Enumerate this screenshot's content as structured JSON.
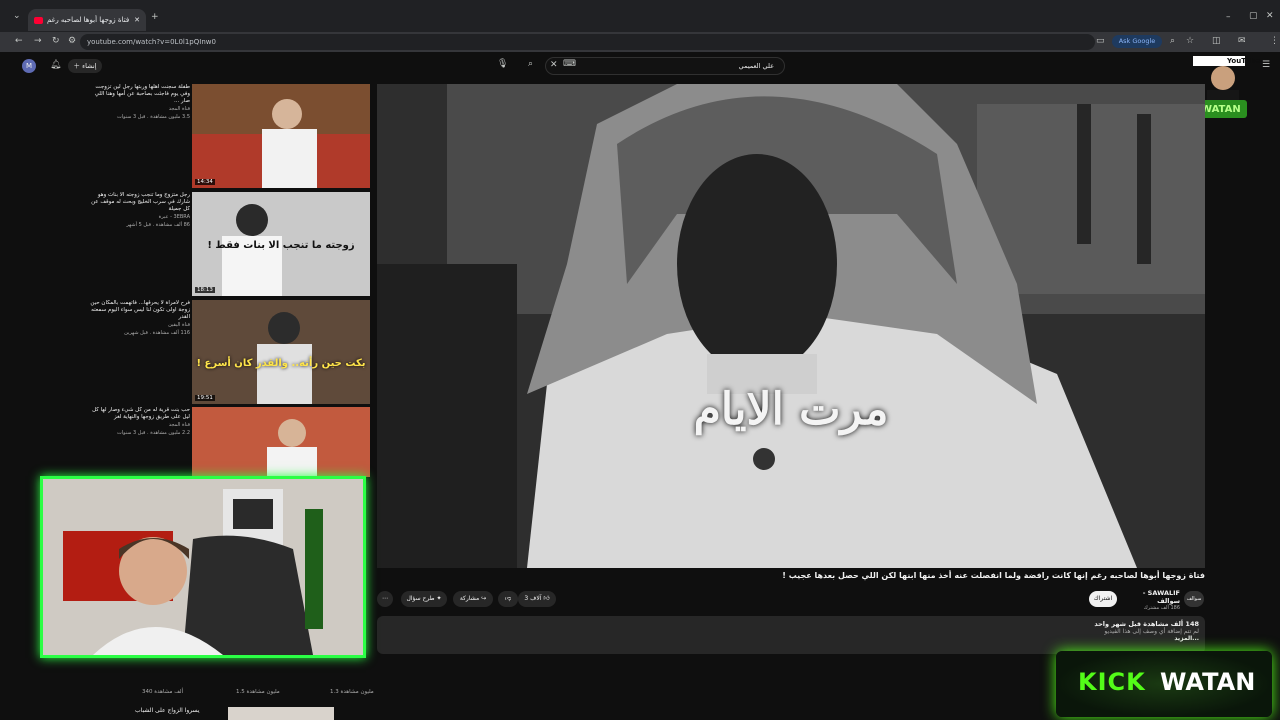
{
  "browser": {
    "tab_title": "فتاة زوجها أبوها لصاحبه رغم",
    "url": "youtube.com/watch?v=0L0l1pQInw0",
    "ask_google": "Ask Google",
    "avatar_letter": "M"
  },
  "masthead": {
    "search_value": "علي العميمي",
    "create_label": "إنشاء",
    "logo_text": "YouTube"
  },
  "player": {
    "overlay_text": "مرت الايام"
  },
  "video": {
    "title": "فتاة زوجها أبوها لصاحبه رغم إنها كانت رافضة ولما انفصلت عنه أخذ منها ابنها لكن اللي حصل بعدها عجيب !",
    "channel": "SAWALIF - سوالف",
    "subscribers": "186 ألف مشترك",
    "subscribe_label": "اشتراك",
    "likes": "3 آلاف",
    "share_label": "مشاركة",
    "ask_label": "طرح سؤال"
  },
  "description": {
    "views_date": "148 ألف مشاهدة قبل شهر واحد",
    "line1": "لم تتم إضافة أي وصف إلى هذا الفيديو",
    "more": "...المزيد"
  },
  "sidebar": {
    "items": [
      {
        "title": "طفلة سجنت أهلها وربتها رجل لين تزوجت وفي يوم فاجئت بصاحبة عن أمها وهنا اللي صار ...",
        "channel": "قناة المجد",
        "views": "3.5 مليون مشاهدة . قبل 3 سنوات",
        "duration": "14:34",
        "caption": ""
      },
      {
        "title": "رجل متزوج وما تنجب زوجته الا بنات وهو شارك في سرب الخليج وبحث له موقف عن كل جميلة",
        "channel": "3EBRA - عبرة",
        "views": "86 ألف مشاهدة . قبل 5 أشهر",
        "duration": "18:13",
        "caption": "زوجته ما تنجب الا بنات فقط !"
      },
      {
        "title": "فرح لامرأة لا يحرقها... فاتهمت بالمكان حين زوجة اولى تكون لنا ليس سواء اليوم سمعته القدر",
        "channel": "قناة اليقين",
        "views": "116 ألف مشاهدة . قبل شهرين",
        "duration": "19:51",
        "caption": "بكت حين رأته.. والقدر كان أسرع !"
      },
      {
        "title": "حب بنت قرية له من كل شيء وصار لها كل ليل على طريق زوجها والنهاية لغز",
        "channel": "قناة المجد",
        "views": "2.2 مليون مشاهدة . قبل 3 سنوات",
        "duration": "",
        "caption": ""
      }
    ],
    "bottom_views": [
      "340 ألف مشاهدة",
      "1.5 مليون مشاهدة",
      "1.3 مليون مشاهدة"
    ],
    "bottom_title": "يسروا الزواج على الشباب"
  },
  "branding": {
    "kick_word": "KICK",
    "streamer": "WATAN",
    "logo_caption": "WATAN"
  },
  "colors": {
    "kick_green": "#53fc18",
    "cam_border": "#2bff45",
    "youtube_red": "#ff0033"
  }
}
